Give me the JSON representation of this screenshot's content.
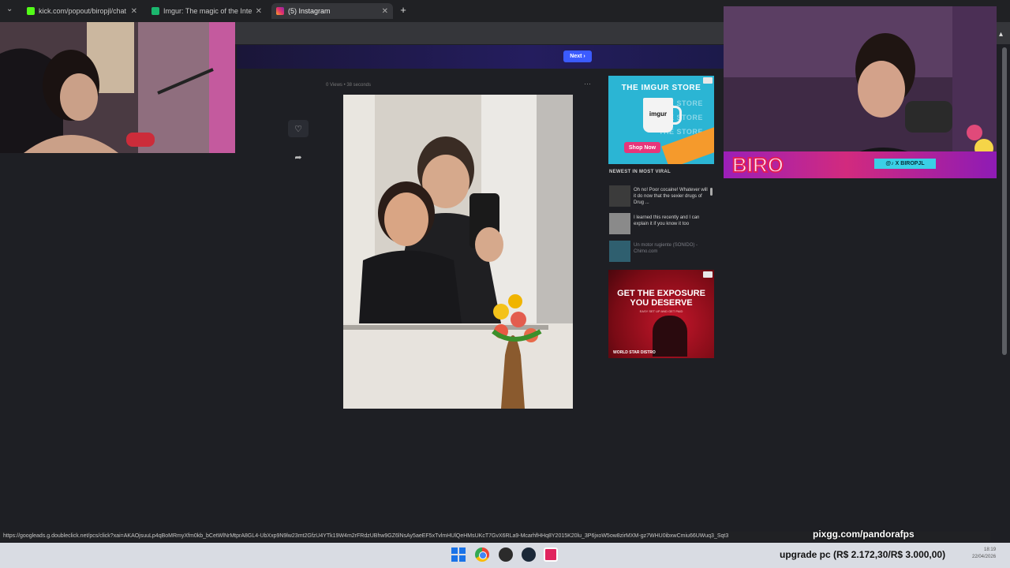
{
  "browser": {
    "tabs": [
      {
        "label": "kick.com/popout/biropjl/chat",
        "favicon_color": "#53fc18"
      },
      {
        "label": "Imgur: The magic of the Interne",
        "favicon_color": "#1bb76e"
      },
      {
        "label": "(5) Instagram",
        "favicon_color": "#e1306c"
      }
    ],
    "status_url": "https://googleads.g.doubleclick.net/pcs/click?xai=AKAOjsuuLp4qBoMRmyXfm0kb_bCetWlNrMtprA8GL4-UbXxp9N9lw23mt2GfzU4YTk19W4m2rFRdzUBhw9GZ6lNsAy5aeEF5xTvlmHUlQeHMsUKcT7GvX6RLa9-McarhfHHq8Y2015K20lu_3P6jxoW5ow8zirMXM-gz7WHU0ibxwCmiu66UWuq3_Sqt3"
  },
  "imgur": {
    "next_label": "Next",
    "post_meta": "0 Views • 38 seconds",
    "store_ad": {
      "title": "THE IMGUR STORE",
      "ghost_line": "THE STORE",
      "mug_label": "imgur",
      "shop_label": "Shop Now"
    },
    "newest_title": "NEWEST IN MOST VIRAL",
    "viral_items": [
      {
        "text": "Oh no! Poor cocaine! Whatever will it do now that the sexier drugs of Drug ...",
        "thumb_color": "#3b3b3b"
      },
      {
        "text": "I learned this recently and I can explain it if you know it too",
        "thumb_color": "#8a8a8a"
      },
      {
        "text": "Un motor rugiente (SONIDO) - Chimo.com",
        "thumb_color": "#2f5f6f"
      }
    ],
    "exposure_ad": {
      "headline": "GET THE EXPOSURE YOU DESERVE",
      "subline": "EASY SET UP AND GET PAID",
      "brand": "WORLD STAR   DISTRO"
    }
  },
  "stream": {
    "social_tag": "@♪ X BIROPJL",
    "graffiti_text": "BIRO",
    "promo": "pixgg.com/pandorafps",
    "upgrade_text": "upgrade pc (R$ 2.172,30/R$ 3.000,00)"
  },
  "taskbar": {
    "icons": [
      "windows-icon",
      "chrome-icon",
      "obs-icon",
      "steam-icon",
      "app-icon"
    ],
    "time": "18:19",
    "date": "22/04/2026"
  }
}
